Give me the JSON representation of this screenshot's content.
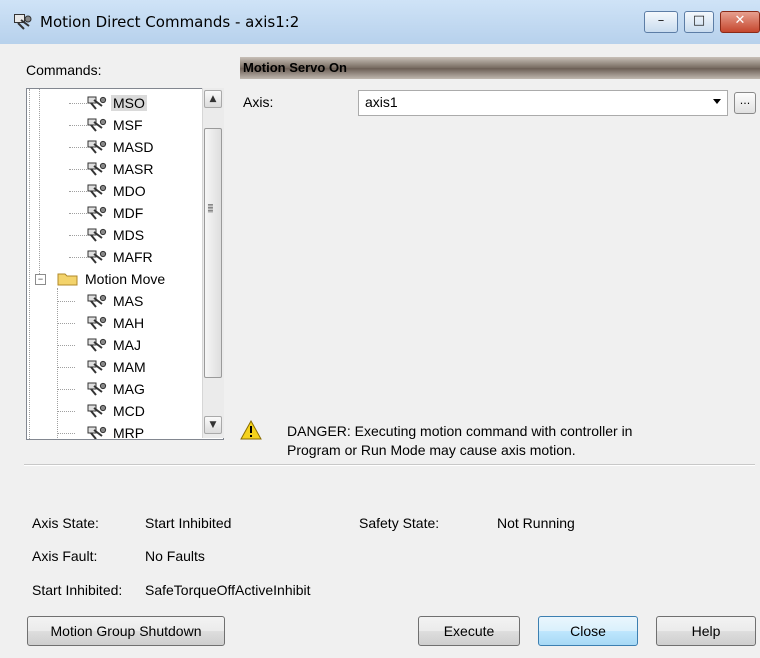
{
  "window": {
    "title": "Motion Direct Commands - axis1:2",
    "min_glyph": "–",
    "max_glyph": "□",
    "close_glyph": "✕"
  },
  "commands": {
    "label": "Commands:",
    "tree": [
      {
        "label": "MSO",
        "type": "command",
        "selected": true
      },
      {
        "label": "MSF",
        "type": "command"
      },
      {
        "label": "MASD",
        "type": "command"
      },
      {
        "label": "MASR",
        "type": "command"
      },
      {
        "label": "MDO",
        "type": "command"
      },
      {
        "label": "MDF",
        "type": "command"
      },
      {
        "label": "MDS",
        "type": "command"
      },
      {
        "label": "MAFR",
        "type": "command"
      },
      {
        "label": "Motion Move",
        "type": "folder",
        "expanded": true
      },
      {
        "label": "MAS",
        "type": "command"
      },
      {
        "label": "MAH",
        "type": "command"
      },
      {
        "label": "MAJ",
        "type": "command"
      },
      {
        "label": "MAM",
        "type": "command"
      },
      {
        "label": "MAG",
        "type": "command"
      },
      {
        "label": "MCD",
        "type": "command"
      },
      {
        "label": "MRP",
        "type": "command"
      }
    ]
  },
  "panel": {
    "header": "Motion Servo On",
    "axis_label": "Axis:",
    "axis_value": "axis1",
    "browse_label": "...",
    "warning_line1": "DANGER: Executing motion command with controller in",
    "warning_line2": "Program or Run Mode may cause axis motion."
  },
  "status": {
    "axis_state_label": "Axis State:",
    "axis_state_value": "Start Inhibited",
    "safety_state_label": "Safety State:",
    "safety_state_value": "Not Running",
    "axis_fault_label": "Axis Fault:",
    "axis_fault_value": "No Faults",
    "start_inhibited_label": "Start Inhibited:",
    "start_inhibited_value": "SafeTorqueOffActiveInhibit"
  },
  "buttons": {
    "shutdown": "Motion Group Shutdown",
    "execute": "Execute",
    "close": "Close",
    "help": "Help"
  },
  "colors": {
    "warning": "#f5d21c",
    "folder": "#f3d36b",
    "default_button_border": "#3c7fb1"
  }
}
